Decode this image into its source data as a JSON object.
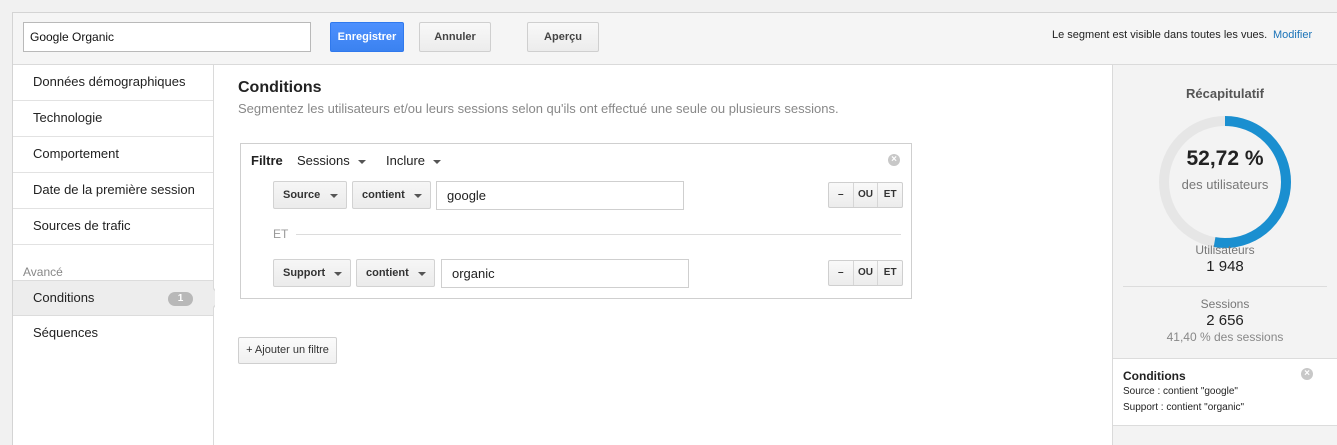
{
  "toolbar": {
    "segment_name": "Google Organic",
    "save_label": "Enregistrer",
    "cancel_label": "Annuler",
    "preview_label": "Aperçu",
    "visibility_text": "Le segment est visible dans toutes les vues.",
    "modify_label": "Modifier"
  },
  "sidebar": {
    "items": [
      {
        "label": "Données démographiques"
      },
      {
        "label": "Technologie"
      },
      {
        "label": "Comportement"
      },
      {
        "label": "Date de la première session"
      },
      {
        "label": "Sources de trafic"
      }
    ],
    "advanced_label": "Avancé",
    "conditions": {
      "label": "Conditions",
      "badge": "1"
    },
    "sequences": {
      "label": "Séquences"
    }
  },
  "main": {
    "title": "Conditions",
    "subtitle": "Segmentez les utilisateurs et/ou leurs sessions selon qu'ils ont effectué une seule ou plusieurs sessions.",
    "filter": {
      "label": "Filtre",
      "scope": "Sessions",
      "mode": "Inclure",
      "close_glyph": "×",
      "rows": [
        {
          "dimension": "Source",
          "operator": "contient",
          "value": "google"
        },
        {
          "dimension": "Support",
          "operator": "contient",
          "value": "organic"
        }
      ],
      "and_label": "ET",
      "actions": {
        "remove": "–",
        "or": "OU",
        "and": "ET"
      }
    },
    "add_filter_label": "+ Ajouter un filtre"
  },
  "summary": {
    "title": "Récapitulatif",
    "percent": "52,72 %",
    "percent_sub": "des utilisateurs",
    "percent_value": 52.72,
    "users_label": "Utilisateurs",
    "users_value": "1 948",
    "sessions_label": "Sessions",
    "sessions_value": "2 656",
    "sessions_pct": "41,40 % des sessions",
    "conditions_title": "Conditions",
    "conditions_line1": "Source : contient \"google\"",
    "conditions_line2": "Support : contient \"organic\"",
    "close_glyph": "×"
  },
  "colors": {
    "accent": "#1a8fd0",
    "save_button": "#4d90fe",
    "link": "#1a73b8",
    "donut_track": "#e6e6e6"
  },
  "icons": {
    "dropdown": "chevron-down-icon",
    "remove": "close-circle-icon",
    "pointer": "arrow-right-icon"
  }
}
